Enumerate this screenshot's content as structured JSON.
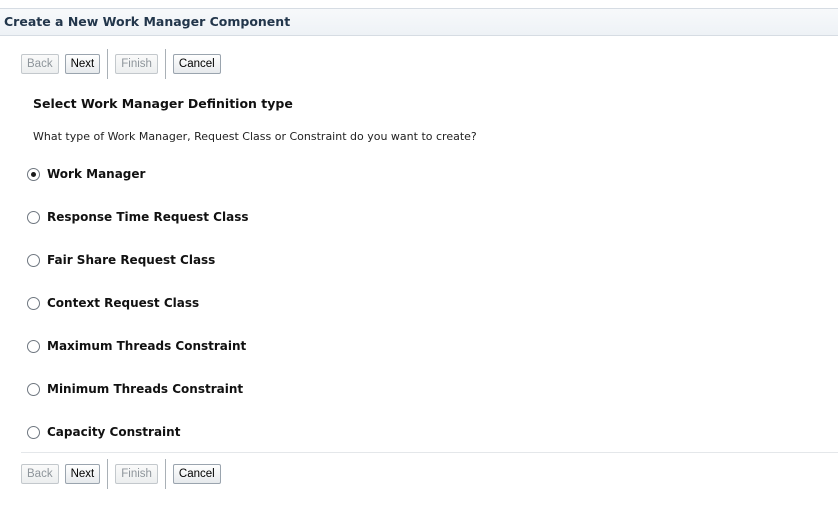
{
  "window": {
    "title": "Create a New Work Manager Component"
  },
  "buttons": {
    "back": "Back",
    "next": "Next",
    "finish": "Finish",
    "cancel": "Cancel"
  },
  "main": {
    "section_title": "Select Work Manager Definition type",
    "question": "What type of Work Manager, Request Class or Constraint do you want to create?",
    "options": [
      {
        "label": "Work Manager",
        "selected": true
      },
      {
        "label": "Response Time Request Class",
        "selected": false
      },
      {
        "label": "Fair Share Request Class",
        "selected": false
      },
      {
        "label": "Context Request Class",
        "selected": false
      },
      {
        "label": "Maximum Threads Constraint",
        "selected": false
      },
      {
        "label": "Minimum Threads Constraint",
        "selected": false
      },
      {
        "label": "Capacity Constraint",
        "selected": false
      }
    ]
  }
}
